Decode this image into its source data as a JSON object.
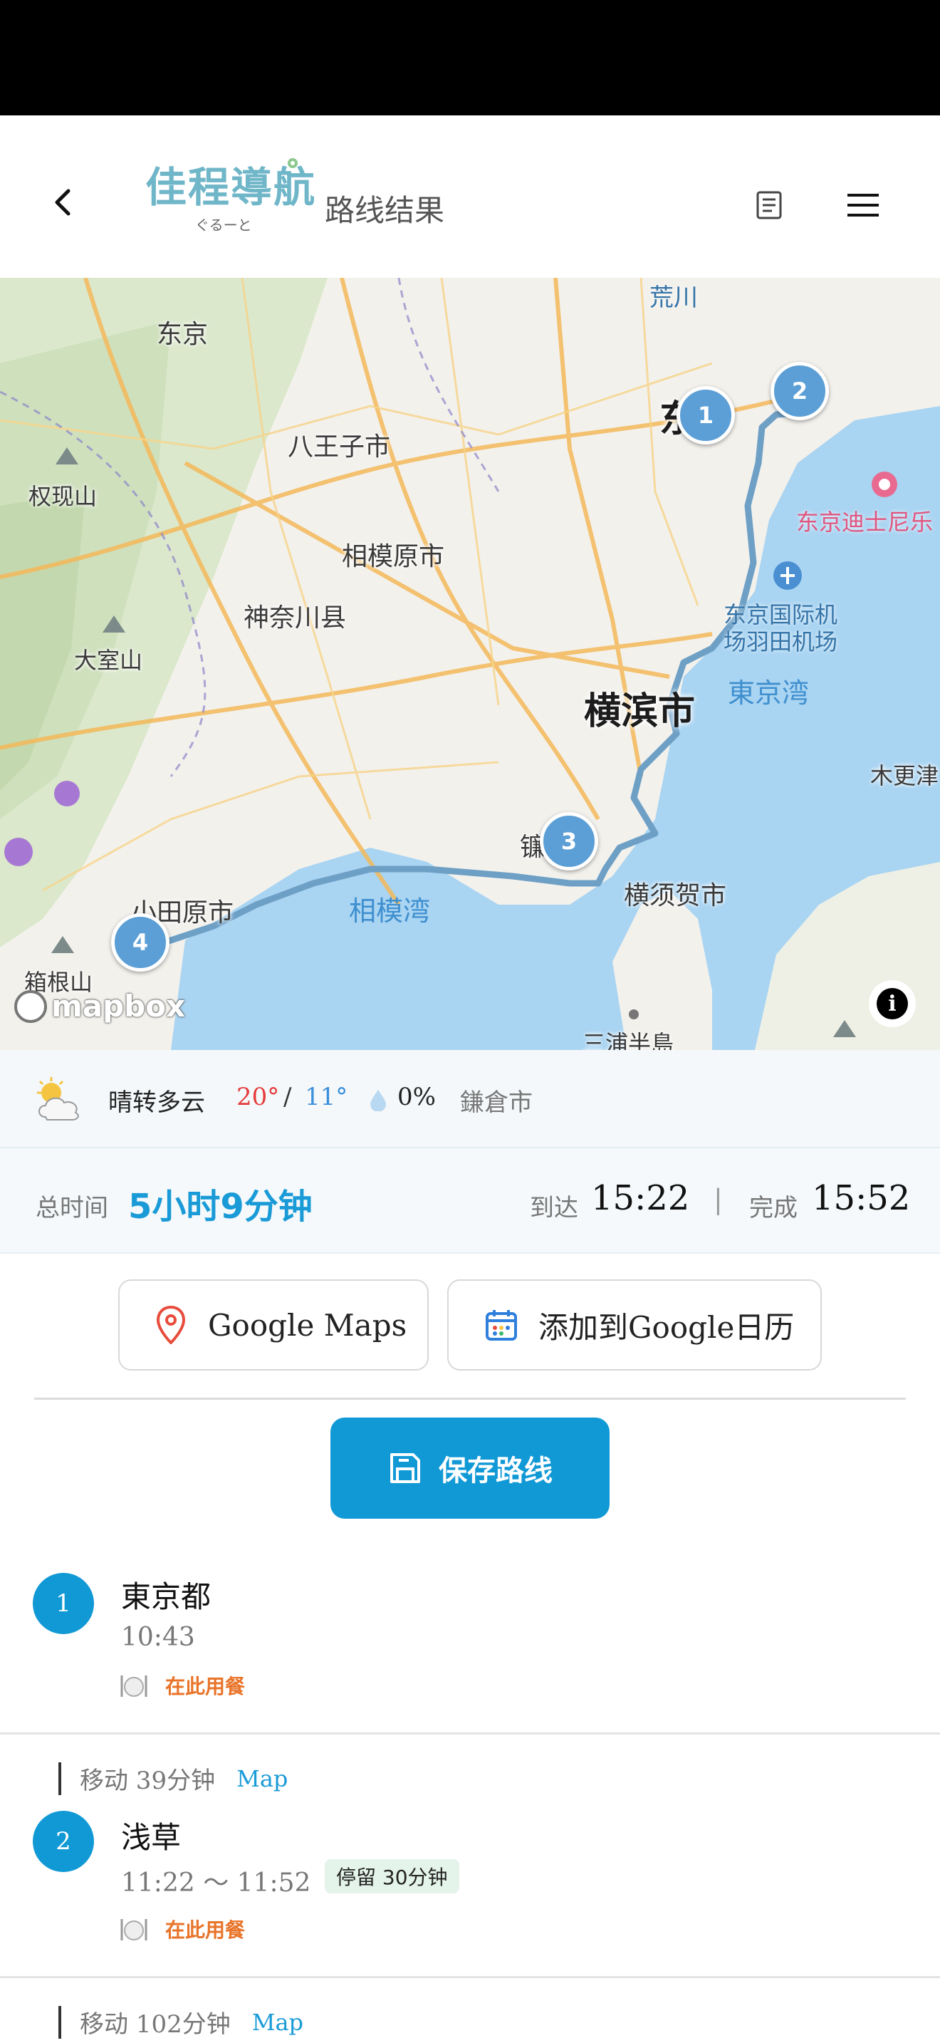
{
  "header": {
    "logo_text": "佳程導航",
    "logo_sub": "ぐるーと",
    "title": "路线结果",
    "back_icon": "chevron-left-icon",
    "doc_icon": "document-icon",
    "menu_icon": "hamburger-menu-icon"
  },
  "map": {
    "labels": {
      "tokyo_pref": "东京",
      "hachioji": "八王子市",
      "gongenyama": "权现山",
      "sagamihara": "相模原市",
      "kanagawa": "神奈川县",
      "omuroyama": "大室山",
      "yokohama": "横滨市",
      "tokyo_bay": "東京湾",
      "haneda": "东京国际机\n场羽田机场",
      "disney": "东京迪士尼乐",
      "arakawa": "荒川",
      "kisarazu": "木更津",
      "sagami_bay": "相模湾",
      "odawara": "小田原市",
      "hakone": "箱根山",
      "yokosuka": "横须贺市",
      "miura": "三浦半島",
      "kamakura": "镰",
      "tokyo_city_part": "东"
    },
    "markers": [
      "1",
      "2",
      "3",
      "4"
    ],
    "attribution": "mapbox",
    "info_icon": "info-icon"
  },
  "weather": {
    "condition": "晴转多云",
    "high": "20°",
    "separator": "/",
    "low": "11°",
    "rain": "0%",
    "city": "鎌倉市"
  },
  "summary": {
    "total_label": "总时间",
    "total": "5小时9分钟",
    "arrive_label": "到达",
    "arrive": "15:22",
    "pipe": "|",
    "done_label": "完成",
    "done": "15:52"
  },
  "actions": {
    "google_maps": "Google Maps",
    "add_calendar": "添加到Google日历",
    "save_route": "保存路线"
  },
  "stops": [
    {
      "num": "1",
      "name": "東京都",
      "time": "10:43",
      "meal": "在此用餐"
    },
    {
      "num": "2",
      "name": "浅草",
      "time": "11:22 〜 11:52",
      "stay": "停留 30分钟",
      "meal": "在此用餐"
    }
  ],
  "moves": [
    {
      "text": "移动 39分钟",
      "link": "Map"
    },
    {
      "text": "移动 102分钟",
      "link": "Map"
    }
  ],
  "colors": {
    "accent": "#1199d6",
    "route": "#5b9fd6",
    "meal": "#e8742a",
    "high": "#e53b3b",
    "low": "#3b8fdc"
  }
}
